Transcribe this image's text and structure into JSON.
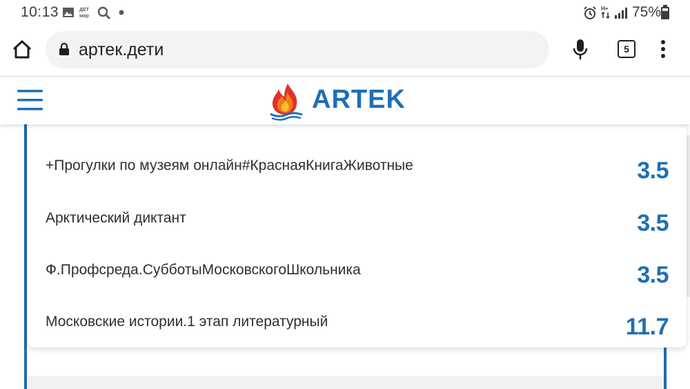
{
  "status_bar": {
    "time": "10:13",
    "notification_icons": [
      "image-icon",
      "detmir-app-icon",
      "search-icon",
      "dot-icon"
    ],
    "system_icons": [
      "alarm-icon",
      "data-arrows-icon",
      "signal-icon",
      "battery-icon"
    ],
    "battery_percent": "75%"
  },
  "browser": {
    "url": "артек.дети",
    "tabs_count": "5",
    "icons": [
      "home-icon",
      "lock-icon",
      "mic-icon",
      "more-vert-icon"
    ]
  },
  "site": {
    "brand": "ARTEK",
    "colors": {
      "brand_blue": "#1e6fb5",
      "flame_orange": "#f07d1a",
      "flame_red": "#e0312b"
    }
  },
  "results": [
    {
      "title": "+Прогулки по музеям онлайн#КраснаяКнигаЖивотные",
      "score": "3.5"
    },
    {
      "title": "Арктический диктант",
      "score": "3.5"
    },
    {
      "title": "Ф.Профсреда.СубботыМосковскогоШкольника",
      "score": "3.5"
    },
    {
      "title": "Московские истории.1 этап литературный",
      "score": "11.7"
    }
  ]
}
